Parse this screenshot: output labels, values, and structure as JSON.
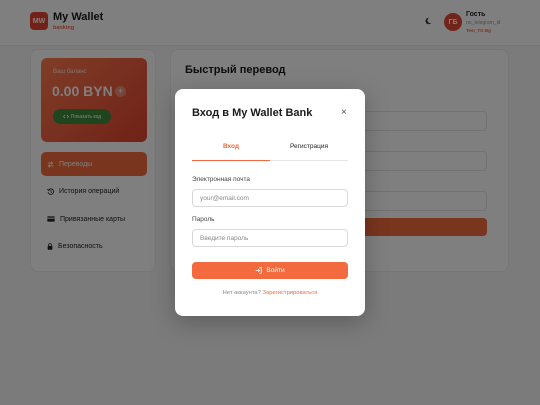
{
  "header": {
    "logo_text": "MW",
    "app_title": "My Wallet",
    "app_subtitle": "banking",
    "avatar_initials": "ГБ",
    "user_name": "Гость",
    "user_handle": "no_telegram_id",
    "user_role": "Test_TG Bg"
  },
  "sidebar": {
    "balance_label": "Ваш баланс",
    "balance_value": "0.00 BYN",
    "plus_symbol": "+",
    "show_code_label": "Показать код",
    "items": [
      {
        "label": "Переводы",
        "icon": "transfer-icon",
        "active": true
      },
      {
        "label": "История операций",
        "icon": "history-icon",
        "active": false
      },
      {
        "label": "Привязанные карты",
        "icon": "card-icon",
        "active": false
      },
      {
        "label": "Безопасность",
        "icon": "lock-icon",
        "active": false
      }
    ]
  },
  "main": {
    "title": "Быстрый перевод"
  },
  "modal": {
    "title": "Вход в My Wallet Bank",
    "close_symbol": "×",
    "tabs": [
      {
        "label": "Вход",
        "active": true
      },
      {
        "label": "Регистрация",
        "active": false
      }
    ],
    "email_label": "Электронная почта",
    "email_placeholder": "your@email.com",
    "email_value": "",
    "password_label": "Пароль",
    "password_placeholder": "Введите пароль",
    "password_value": "",
    "login_button": "Войти",
    "footer_text": "Нет аккаунта?",
    "footer_link": "Зарегистрироваться"
  },
  "colors": {
    "accent": "#f26a3d",
    "brand_red": "#e2432e",
    "code_button_green": "#3f8b3f"
  }
}
